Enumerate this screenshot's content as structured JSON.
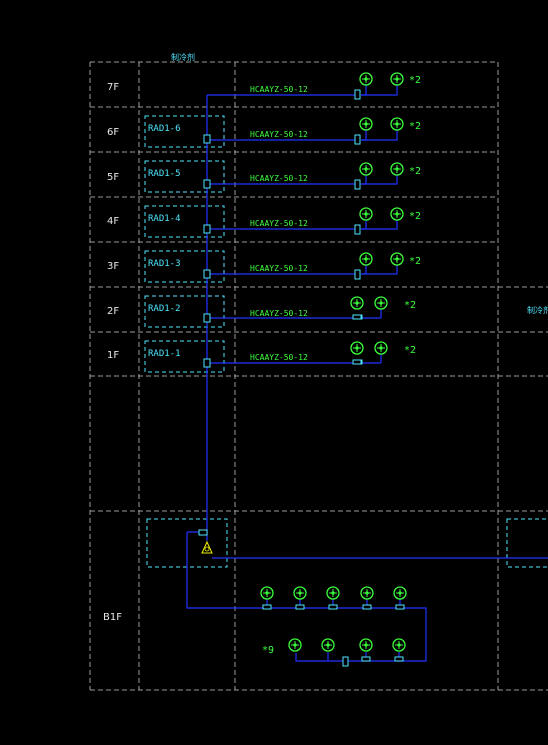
{
  "header": {
    "top_label": "制冷剂",
    "right_label": "制冷剂"
  },
  "floors": [
    {
      "label": "7F",
      "unit": "",
      "pipe_spec": "HCAAYZ-50-12",
      "multiplier": "*2"
    },
    {
      "label": "6F",
      "unit": "RAD1-6",
      "pipe_spec": "HCAAYZ-50-12",
      "multiplier": "*2"
    },
    {
      "label": "5F",
      "unit": "RAD1-5",
      "pipe_spec": "HCAAYZ-50-12",
      "multiplier": "*2"
    },
    {
      "label": "4F",
      "unit": "RAD1-4",
      "pipe_spec": "HCAAYZ-50-12",
      "multiplier": "*2"
    },
    {
      "label": "3F",
      "unit": "RAD1-3",
      "pipe_spec": "HCAAYZ-50-12",
      "multiplier": "*2"
    },
    {
      "label": "2F",
      "unit": "RAD1-2",
      "pipe_spec": "HCAAYZ-50-12",
      "multiplier": "*2"
    },
    {
      "label": "1F",
      "unit": "RAD1-1",
      "pipe_spec": "HCAAYZ-50-12",
      "multiplier": "*2"
    }
  ],
  "basement": {
    "label": "B1F",
    "multiplier": "*9"
  },
  "colors": {
    "grid": "#9a9a9a",
    "unit_box": "#4fe6ff",
    "pipe": "#2233ff",
    "nozzle": "#3dff3d",
    "text_green": "#3dff3d",
    "text_cyan": "#4fe6ff"
  },
  "icons": [
    "nozzle-icon",
    "valve-icon",
    "cylinder-station-icon"
  ]
}
